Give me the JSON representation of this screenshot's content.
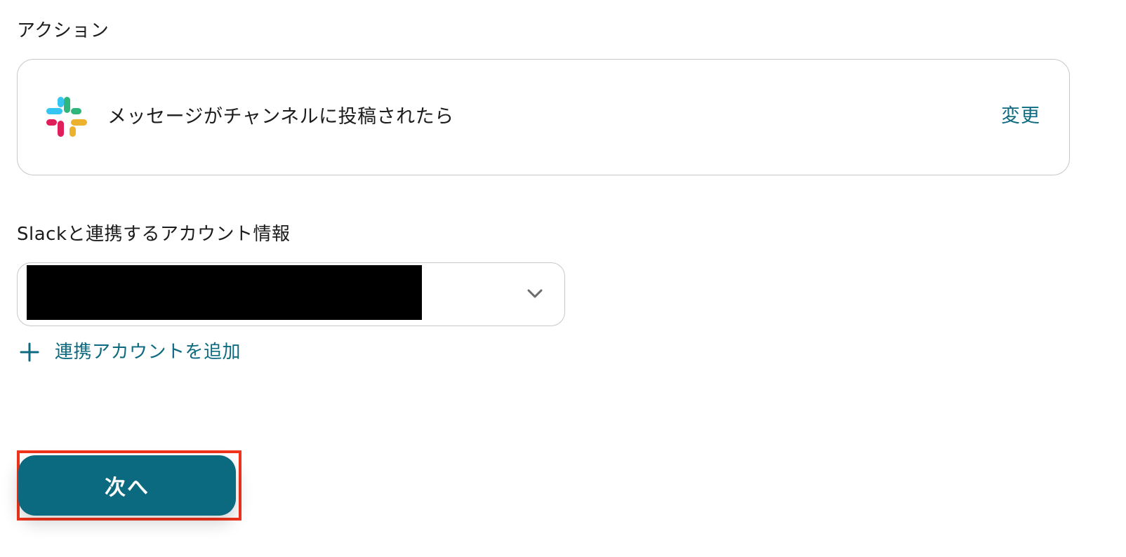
{
  "sections": {
    "action_title": "アクション",
    "account_title": "Slackと連携するアカウント情報"
  },
  "action": {
    "app_icon": "slack-logo",
    "name": "メッセージがチャンネルに投稿されたら",
    "change_label": "変更"
  },
  "account": {
    "selected_value": "",
    "dropdown_icon": "chevron-down-icon",
    "add_icon": "plus-icon",
    "add_label": "連携アカウントを追加"
  },
  "footer": {
    "next_label": "次へ"
  },
  "colors": {
    "accent": "#0e6a80",
    "button": "#0b6a80",
    "highlight": "#f2331b",
    "border": "#c8c8c8",
    "slack_blue": "#36c5f0",
    "slack_green": "#2eb67d",
    "slack_red": "#e01e5a",
    "slack_yellow": "#ecb22e"
  }
}
